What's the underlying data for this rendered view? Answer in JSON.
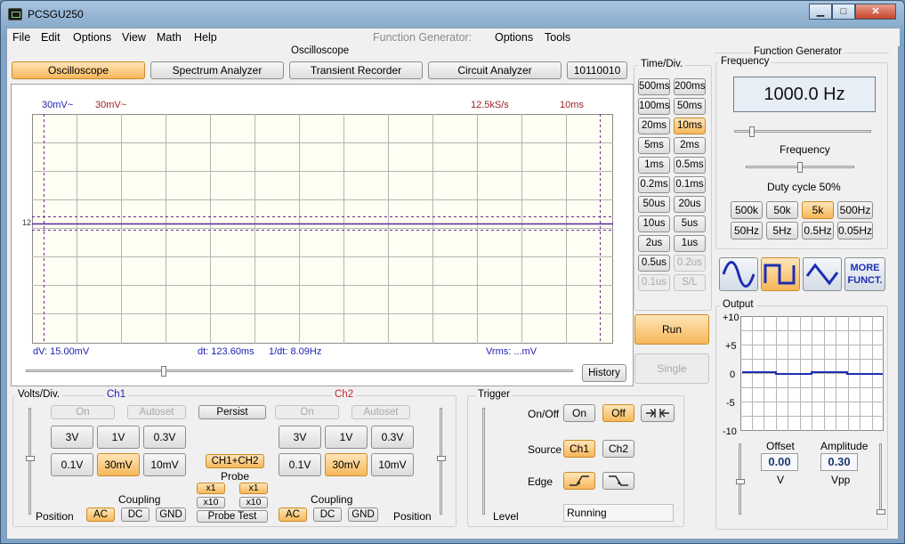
{
  "window": {
    "title": "PCSGU250",
    "min_label": "▁",
    "max_label": "□",
    "close_label": "✕"
  },
  "menu": {
    "left": [
      "File",
      "Edit",
      "Options",
      "View",
      "Math",
      "Help"
    ],
    "fg_label": "Function Generator:",
    "fg_items": [
      "Options",
      "Tools"
    ]
  },
  "oscilloscope": {
    "group_title": "Oscilloscope",
    "tabs": [
      "Oscilloscope",
      "Spectrum Analyzer",
      "Transient Recorder",
      "Circuit Analyzer",
      "10110010"
    ],
    "active_tab": 0,
    "screen": {
      "ch1_scale": "30mV~",
      "ch2_scale": "30mV~",
      "sample_rate": "12.5kS/s",
      "time_div": "10ms",
      "level_marker": "12",
      "dv": "dV: 15.00mV",
      "dt": "dt: 123.60ms",
      "inv_dt": "1/dt: 8.09Hz",
      "vrms": "Vrms: ...mV"
    },
    "history_label": "History"
  },
  "time_div": {
    "title": "Time/Div.",
    "buttons": [
      [
        "500ms",
        "200ms"
      ],
      [
        "100ms",
        "50ms"
      ],
      [
        "20ms",
        "10ms"
      ],
      [
        "5ms",
        "2ms"
      ],
      [
        "1ms",
        "0.5ms"
      ],
      [
        "0.2ms",
        "0.1ms"
      ],
      [
        "50us",
        "20us"
      ],
      [
        "10us",
        "5us"
      ],
      [
        "2us",
        "1us"
      ],
      [
        "0.5us",
        "0.2us"
      ],
      [
        "0.1us",
        "S/L"
      ]
    ],
    "selected": "10ms",
    "disabled": [
      "0.2us",
      "0.1us",
      "S/L"
    ],
    "run_label": "Run",
    "single_label": "Single"
  },
  "volts_div": {
    "title": "Volts/Div.",
    "ch1_label": "Ch1",
    "ch2_label": "Ch2",
    "on_label": "On",
    "autoset_label": "Autoset",
    "persist_label": "Persist",
    "row1": [
      "3V",
      "1V",
      "0.3V"
    ],
    "row2": [
      "0.1V",
      "30mV",
      "10mV"
    ],
    "selected": "30mV",
    "ch1ch2_label": "CH1+CH2",
    "probe_label": "Probe",
    "x1_label": "x1",
    "x10_label": "x10",
    "probe_test_label": "Probe Test",
    "coupling_label": "Coupling",
    "coupling": [
      "AC",
      "DC",
      "GND"
    ],
    "coupling_selected": "AC",
    "position_label": "Position"
  },
  "trigger": {
    "title": "Trigger",
    "onoff_label": "On/Off",
    "on_label": "On",
    "off_label": "Off",
    "off_selected": true,
    "source_label": "Source",
    "sources": [
      "Ch1",
      "Ch2"
    ],
    "source_selected": "Ch1",
    "edge_label": "Edge",
    "level_label": "Level",
    "status": "Running"
  },
  "function_generator": {
    "group_title": "Function Generator",
    "frequency_title": "Frequency",
    "frequency_value": "1000.0 Hz",
    "frequency_slider_label": "Frequency",
    "duty_label": "Duty cycle 50%",
    "range_buttons": [
      [
        "500k",
        "50k",
        "5k",
        "500Hz"
      ],
      [
        "50Hz",
        "5Hz",
        "0.5Hz",
        "0.05Hz"
      ]
    ],
    "range_selected": "5k",
    "more_label_1": "MORE",
    "more_label_2": "FUNCT.",
    "output_title": "Output",
    "y_ticks": [
      "+10",
      "+5",
      "0",
      "-5",
      "-10"
    ],
    "offset_label": "Offset",
    "offset_value": "0.00",
    "offset_unit": "V",
    "amplitude_label": "Amplitude",
    "amplitude_value": "0.30",
    "amplitude_unit": "Vpp"
  },
  "colors": {
    "accent_on": "#f6b75a",
    "trace": "#5a2aa0",
    "ch1": "#1d1db3",
    "ch2": "#9b1f1f",
    "fg_wave": "#1b2fb0"
  }
}
